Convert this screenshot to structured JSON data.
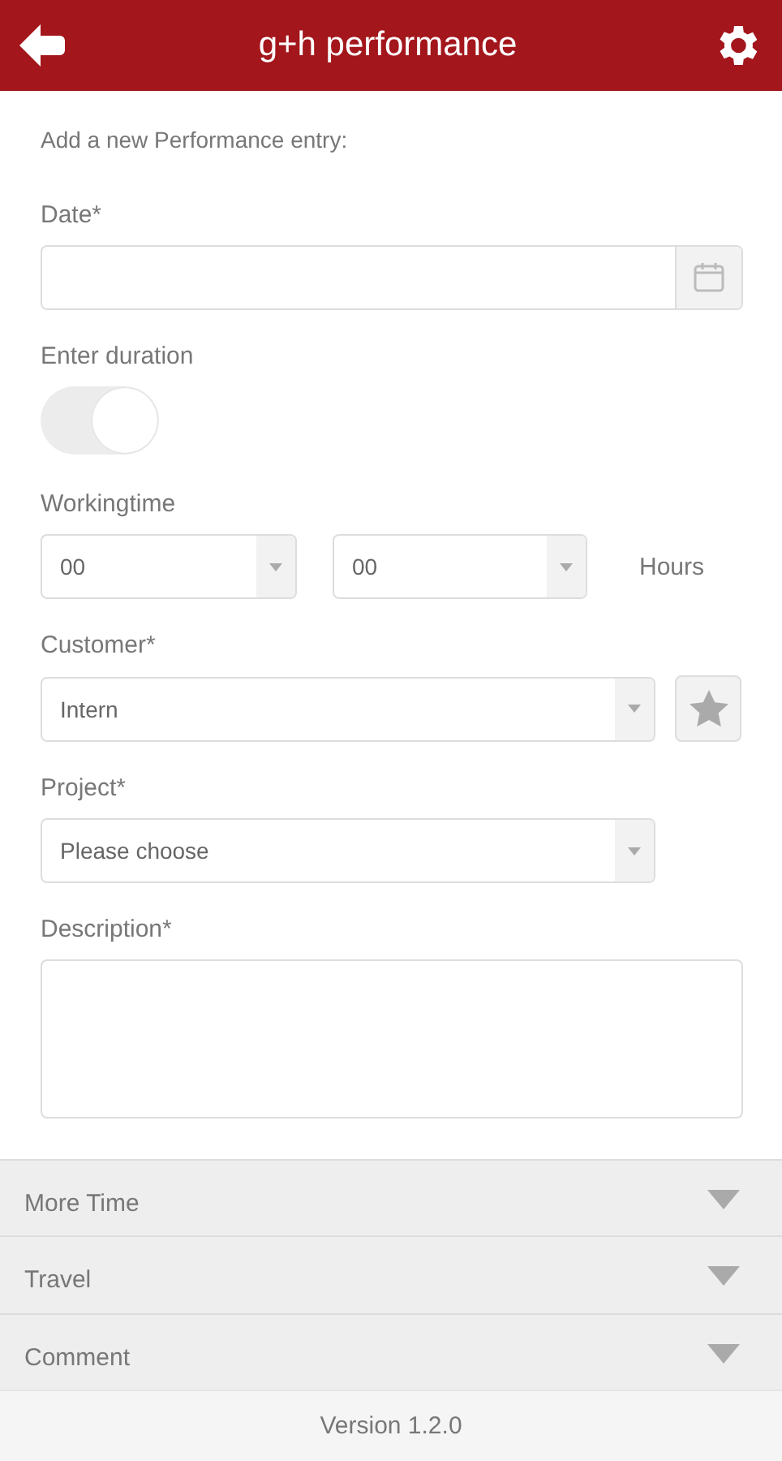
{
  "header": {
    "title": "g+h performance"
  },
  "intro": "Add a new Performance entry:",
  "date": {
    "label": "Date*"
  },
  "duration": {
    "label": "Enter duration",
    "on": false
  },
  "workingtime": {
    "label": "Workingtime",
    "hours_value": "00",
    "minutes_value": "00",
    "unit": "Hours"
  },
  "customer": {
    "label": "Customer*",
    "value": "Intern"
  },
  "project": {
    "label": "Project*",
    "value": "Please choose"
  },
  "description": {
    "label": "Description*"
  },
  "sections": [
    {
      "label": "More Time",
      "expanded": false
    },
    {
      "label": "Travel",
      "expanded": false
    },
    {
      "label": "Comment",
      "expanded": false
    }
  ],
  "footer": {
    "version": "Version 1.2.0"
  }
}
